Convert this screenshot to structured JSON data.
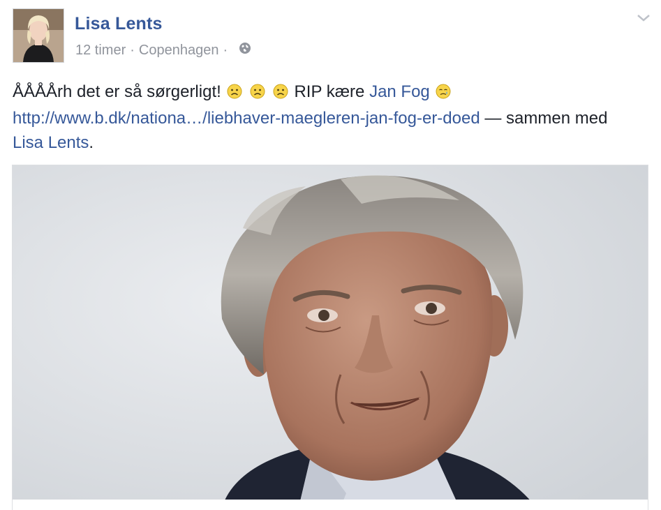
{
  "post": {
    "author": "Lisa Lents",
    "time": "12 timer",
    "separator": "·",
    "location": "Copenhagen",
    "text_intro": "ÅÅÅÅrh det er så sørgerligt!",
    "text_rip": "RIP kære",
    "tagged_person": "Jan Fog",
    "url_text": "http://www.b.dk/nationa…/liebhaver-maegleren-jan-fog-er-doed",
    "with_text": "— sammen med",
    "with_person": "Lisa Lents",
    "with_end": "."
  },
  "colors": {
    "link": "#365899",
    "meta": "#90949c",
    "text": "#1d2129"
  },
  "icons": {
    "privacy": "globe-icon",
    "menu": "chevron-down-icon",
    "emoji_sad": "sad-face-emoji",
    "emoji_cry": "crying-face-emoji"
  }
}
